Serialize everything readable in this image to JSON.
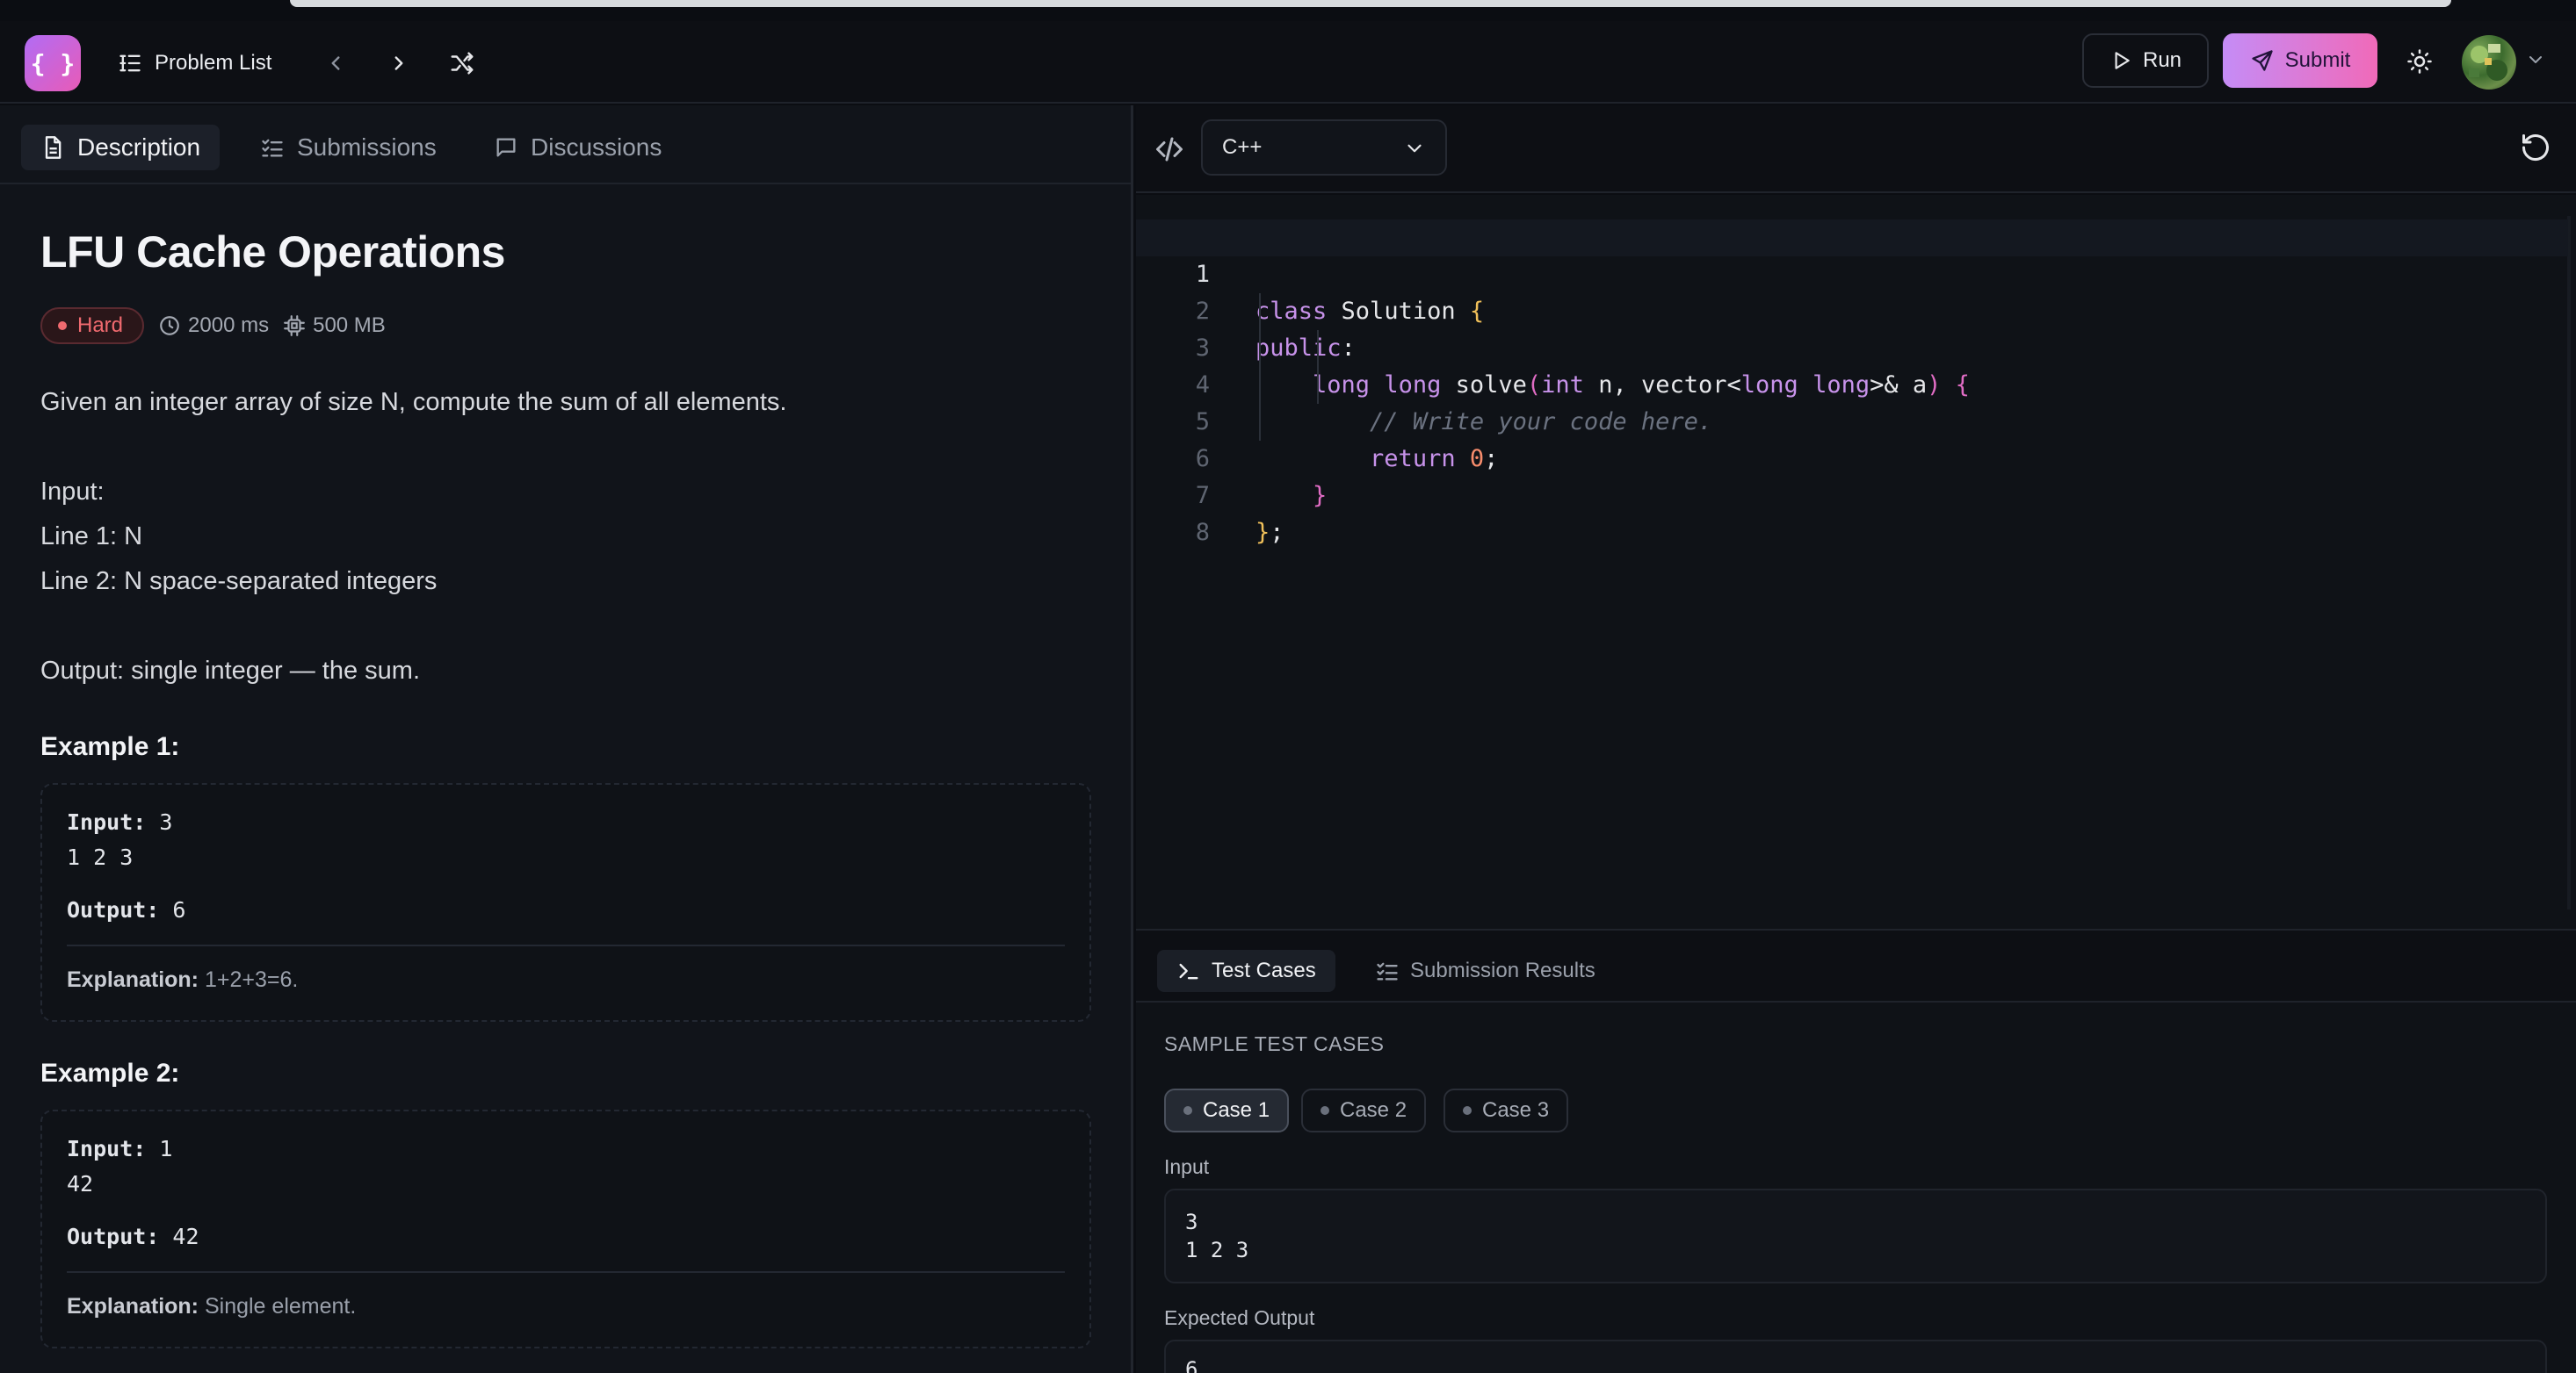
{
  "header": {
    "logo_text": "{ }",
    "problem_list_label": "Problem List",
    "run_label": "Run",
    "submit_label": "Submit"
  },
  "left_tabs": [
    {
      "label": "Description",
      "icon": "document-icon",
      "active": true
    },
    {
      "label": "Submissions",
      "icon": "checklist-icon",
      "active": false
    },
    {
      "label": "Discussions",
      "icon": "chat-icon",
      "active": false
    }
  ],
  "problem": {
    "title": "LFU Cache Operations",
    "difficulty": "Hard",
    "time_limit": "2000 ms",
    "memory_limit": "500 MB",
    "description_lines": [
      "Given an integer array of size N, compute the sum of all elements.",
      "Input:",
      "Line 1: N",
      "Line 2: N space-separated integers",
      "Output: single integer — the sum."
    ],
    "examples": [
      {
        "title": "Example 1:",
        "input_label": "Input:",
        "input_first": "3",
        "input_rest": "1 2 3",
        "output_label": "Output:",
        "output": "6",
        "explanation_label": "Explanation:",
        "explanation": "1+2+3=6."
      },
      {
        "title": "Example 2:",
        "input_label": "Input:",
        "input_first": "1",
        "input_rest": "42",
        "output_label": "Output:",
        "output": "42",
        "explanation_label": "Explanation:",
        "explanation": "Single element."
      }
    ]
  },
  "editor": {
    "language": "C++",
    "line_numbers": [
      "1",
      "2",
      "3",
      "4",
      "5",
      "6",
      "7",
      "8"
    ],
    "active_line": 1
  },
  "bottom_tabs": [
    {
      "label": "Test Cases",
      "icon": "terminal-icon",
      "active": true
    },
    {
      "label": "Submission Results",
      "icon": "checklist-icon",
      "active": false
    }
  ],
  "testcases": {
    "section_title": "SAMPLE TEST CASES",
    "cases": [
      "Case 1",
      "Case 2",
      "Case 3"
    ],
    "active_case": "Case 1",
    "input_label": "Input",
    "input_value": "3\n1 2 3",
    "expected_label": "Expected Output",
    "expected_value": "6"
  },
  "colors": {
    "accent_start": "#c58cf6",
    "accent_end": "#f06ab9",
    "hard": "#f06a6f",
    "background": "#0b0d12"
  }
}
